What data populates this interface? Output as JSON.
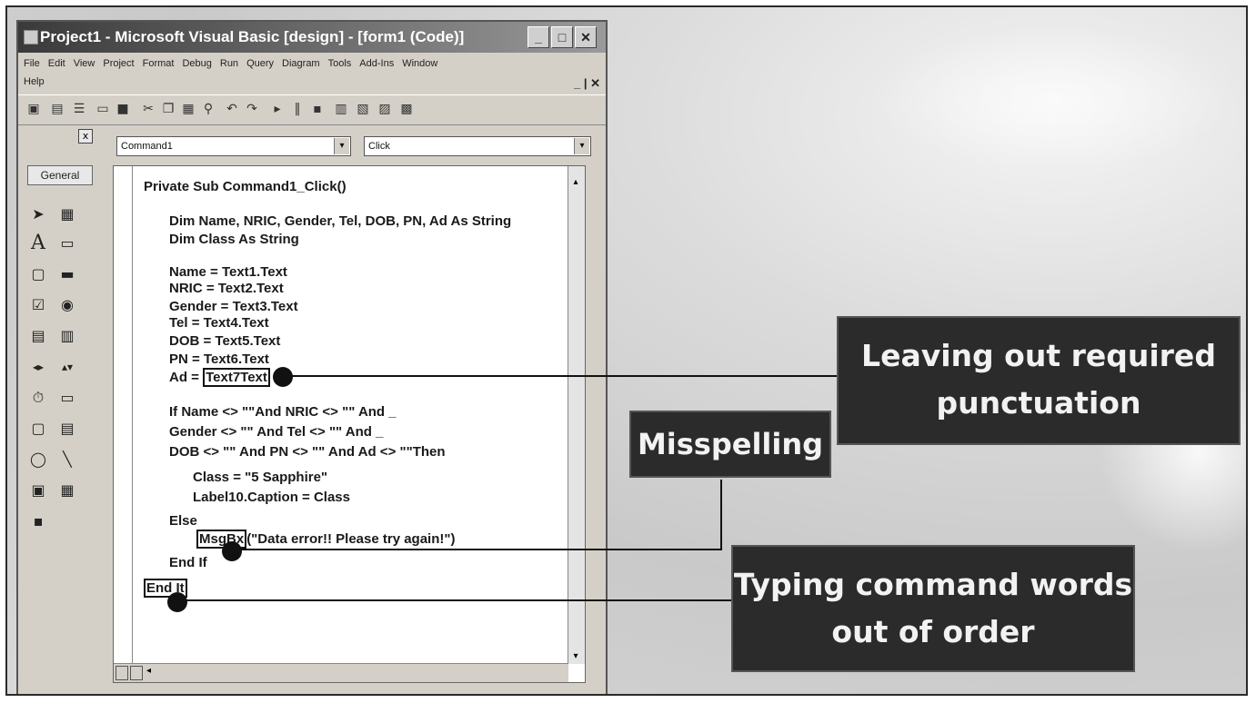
{
  "window": {
    "title": "Project1 - Microsoft Visual Basic [design] - [form1 (Code)]",
    "min_label": "_",
    "max_label": "□",
    "close_label": "✕"
  },
  "menu": {
    "row1": [
      "File",
      "Edit",
      "View",
      "Project",
      "Format",
      "Debug",
      "Run",
      "Query",
      "Diagram",
      "Tools",
      "Add-Ins",
      "Window"
    ],
    "row2": [
      "Help"
    ],
    "mdi_controls": "_ | ✕"
  },
  "toolbox": {
    "close_label": "x",
    "tab_label": "General"
  },
  "code_window": {
    "object_combo": "Command1",
    "proc_combo": "Click"
  },
  "code": {
    "l1": "Private Sub Command1_Click()",
    "l2": "Dim Name, NRIC, Gender, Tel, DOB, PN, Ad As String",
    "l3": "Dim Class As String",
    "l4": "Name = Text1.Text",
    "l5": "NRIC = Text2.Text",
    "l6": "Gender = Text3.Text",
    "l7": "Tel = Text4.Text",
    "l8": "DOB = Text5.Text",
    "l9": "PN = Text6.Text",
    "l10_pre": "Ad = ",
    "l10_boxed": "Text7Text",
    "l11": "If Name <> \"\"And NRIC <> \"\" And _",
    "l12": "Gender <> \"\" And Tel <> \"\" And _",
    "l13": "DOB <> \"\" And PN <> \"\" And Ad <> \"\"Then",
    "l14": "Class = \"5 Sapphire\"",
    "l15": "Label10.Caption = Class",
    "l16": "Else",
    "l17_boxed": "MsgBx",
    "l17_post": "(\"Data error!! Please try again!\")",
    "l18": "End If",
    "l19_boxed": "End It"
  },
  "annotations": {
    "punctuation": "Leaving out required punctuation",
    "misspelling": "Misspelling",
    "order": "Typing command words out of order"
  }
}
